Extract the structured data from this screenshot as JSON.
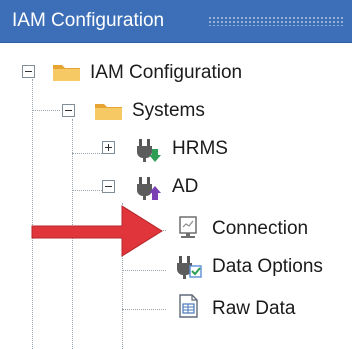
{
  "window": {
    "title": "IAM Configuration"
  },
  "tree": {
    "root": {
      "label": "IAM Configuration",
      "icon": "folder-icon",
      "expanded": true
    },
    "systems": {
      "label": "Systems",
      "icon": "folder-icon",
      "expanded": true
    },
    "hrms": {
      "label": "HRMS",
      "icon": "plug-down-icon",
      "expanded": false
    },
    "ad": {
      "label": "AD",
      "icon": "plug-up-icon",
      "expanded": true
    },
    "connection": {
      "label": "Connection",
      "icon": "connection-monitor-icon"
    },
    "data_options": {
      "label": "Data Options",
      "icon": "plug-check-icon"
    },
    "raw_data": {
      "label": "Raw Data",
      "icon": "raw-data-doc-icon"
    }
  },
  "annotation": {
    "icon": "red-arrow-icon",
    "color": "#e0353b"
  },
  "colors": {
    "titlebar": "#3c6fb7",
    "folder": "#f0b84a",
    "accent_green": "#2f9e55",
    "accent_purple": "#7b3fb4"
  }
}
